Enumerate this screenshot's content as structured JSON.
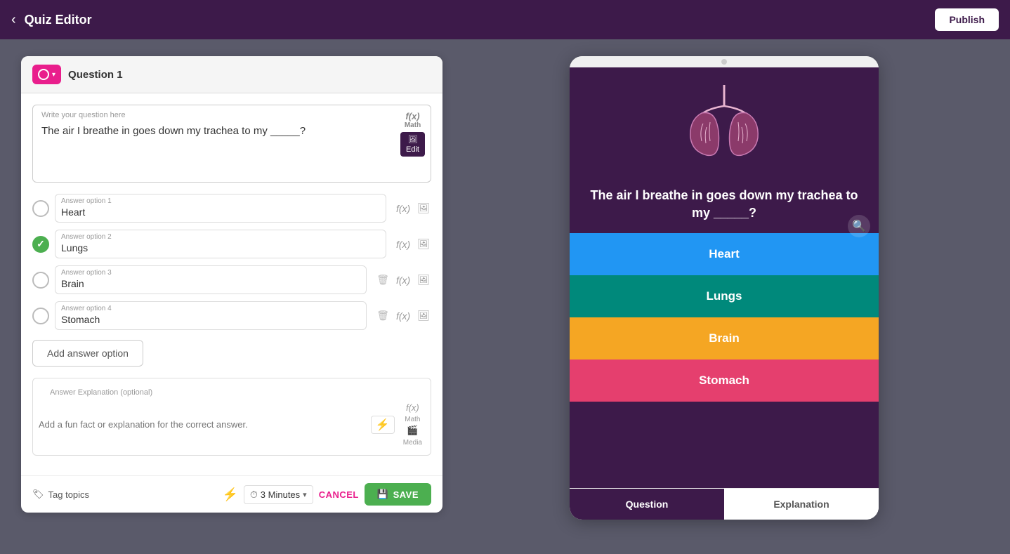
{
  "header": {
    "title": "Quiz Editor",
    "back_label": "‹",
    "publish_label": "Publish"
  },
  "editor": {
    "question_number": "Question 1",
    "question_placeholder": "Write your question here",
    "question_text": "The air I breathe in goes down my trachea to my _____?",
    "math_label": "Math",
    "edit_label": "Edit",
    "fx_symbol": "f(x)",
    "answers": [
      {
        "label": "Answer option 1",
        "value": "Heart",
        "is_correct": false
      },
      {
        "label": "Answer option 2",
        "value": "Lungs",
        "is_correct": true
      },
      {
        "label": "Answer option 3",
        "value": "Brain",
        "is_correct": false
      },
      {
        "label": "Answer option 4",
        "value": "Stomach",
        "is_correct": false
      }
    ],
    "add_answer_label": "Add answer option",
    "explanation_header": "Answer Explanation (optional)",
    "explanation_placeholder": "Add a fun fact or explanation for the correct answer.",
    "tag_topics_label": "Tag topics",
    "timer_label": "3 Minutes",
    "cancel_label": "CANCEL",
    "save_label": "SAVE"
  },
  "preview": {
    "question_text": "The air I breathe in goes down my trachea to my _____?",
    "answers": [
      {
        "label": "Heart",
        "color": "blue"
      },
      {
        "label": "Lungs",
        "color": "teal"
      },
      {
        "label": "Brain",
        "color": "orange"
      },
      {
        "label": "Stomach",
        "color": "pink"
      }
    ],
    "tab_question": "Question",
    "tab_explanation": "Explanation"
  }
}
